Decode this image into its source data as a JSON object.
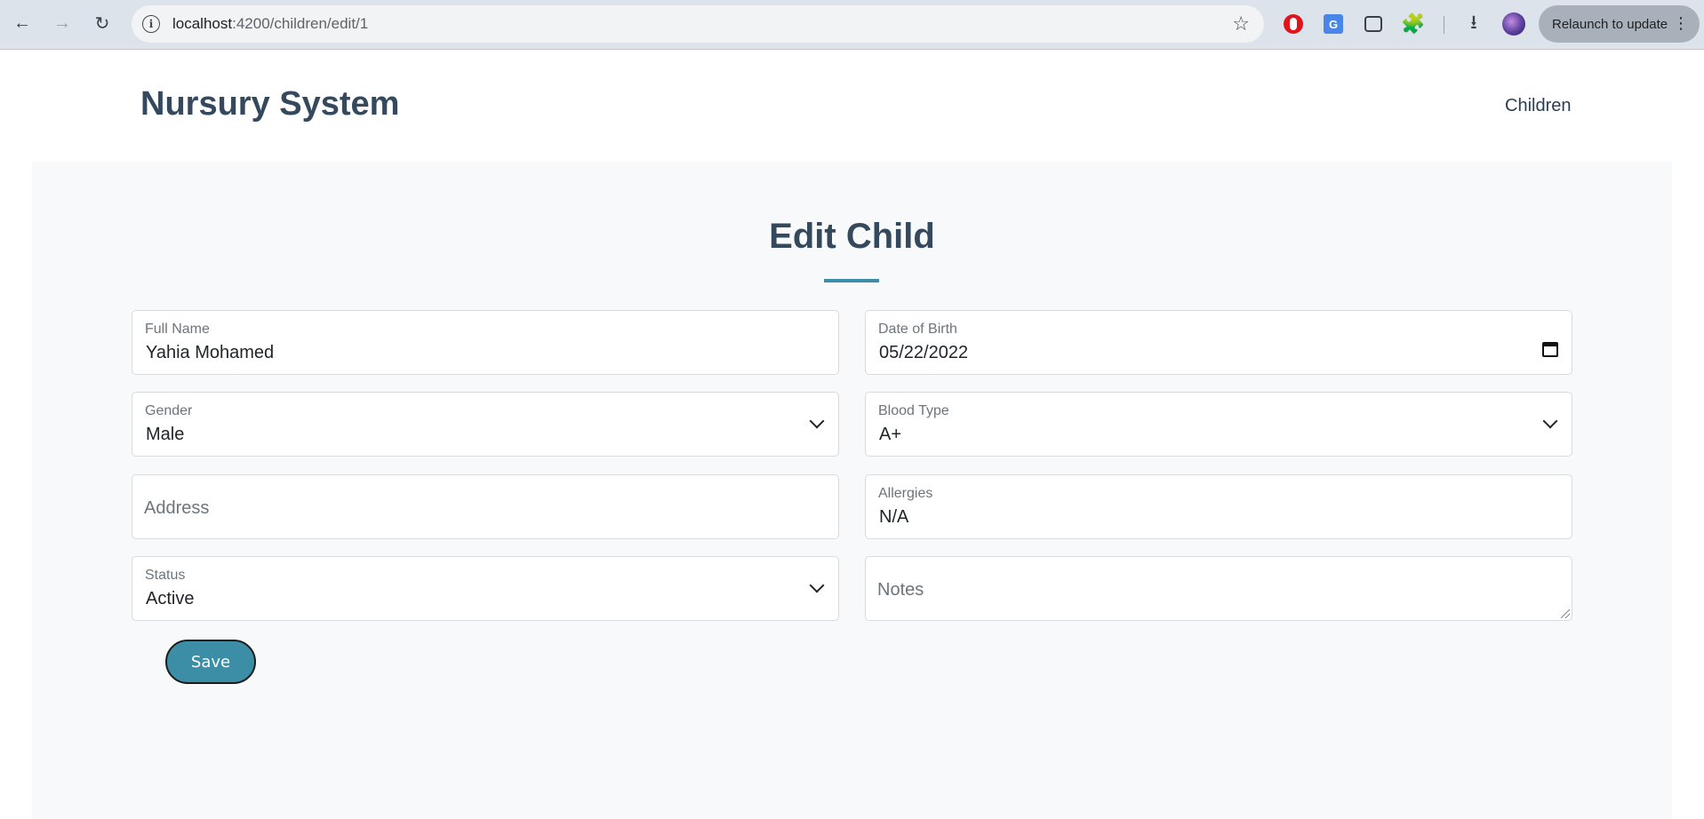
{
  "browser": {
    "url_host": "localhost",
    "url_path": ":4200/children/edit/1",
    "relaunch_label": "Relaunch to update",
    "icons": {
      "back": "arrow-left",
      "forward": "arrow-right",
      "reload": "reload",
      "info": "info",
      "bookmark": "star",
      "extensions": "puzzle",
      "download": "download"
    }
  },
  "header": {
    "site_title": "Nursury System",
    "nav_children": "Children"
  },
  "form": {
    "title": "Edit Child",
    "full_name": {
      "label": "Full Name",
      "value": "Yahia Mohamed"
    },
    "date_of_birth": {
      "label": "Date of Birth",
      "value": "05/22/2022"
    },
    "gender": {
      "label": "Gender",
      "value": "Male"
    },
    "blood_type": {
      "label": "Blood Type",
      "value": "A+"
    },
    "address": {
      "placeholder": "Address"
    },
    "allergies": {
      "label": "Allergies",
      "value": "N/A"
    },
    "status": {
      "label": "Status",
      "value": "Active"
    },
    "notes": {
      "placeholder": "Notes"
    },
    "save_label": "Save"
  },
  "colors": {
    "accent": "#3b8ea5",
    "title_text": "#34495e",
    "panel_bg": "#f7f9fa"
  }
}
